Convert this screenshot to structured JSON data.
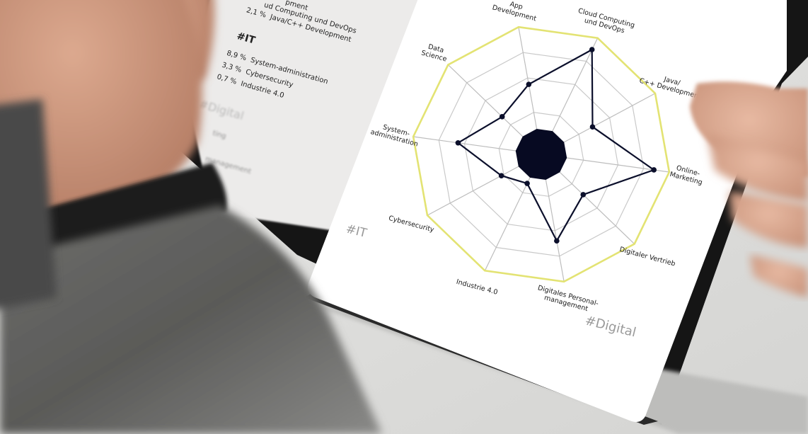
{
  "sidebar": {
    "top_line_partial": "ud Computing und DevOps",
    "top_line_partial2": "pment",
    "top_stat": {
      "value": "2,1 %",
      "label": "Java/C++ Development"
    },
    "it_heading": "#IT",
    "it_stats": [
      {
        "value": "8,9 %",
        "label": "System-administration"
      },
      {
        "value": "3,3 %",
        "label": "Cybersecurity"
      },
      {
        "value": "0,7 %",
        "label": "Industrie 4.0"
      }
    ],
    "digital_heading": "#Digital",
    "digital_partial_1": "ting",
    "digital_partial_2": "management"
  },
  "radar": {
    "axes": [
      {
        "lines": [
          "App",
          "Development"
        ]
      },
      {
        "lines": [
          "Cloud Computing",
          "und DevOps"
        ]
      },
      {
        "lines": [
          "Java/",
          "C++ Development"
        ]
      },
      {
        "lines": [
          "Online-",
          "Marketing"
        ]
      },
      {
        "lines": [
          "Digitaler Vertrieb"
        ]
      },
      {
        "lines": [
          "Digitales Personal-",
          "management"
        ]
      },
      {
        "lines": [
          "Industrie 4.0"
        ]
      },
      {
        "lines": [
          "Cybersecurity"
        ]
      },
      {
        "lines": [
          "System-",
          "administration"
        ]
      },
      {
        "lines": [
          "Data",
          "Science"
        ]
      }
    ],
    "levels": [
      0.55,
      0.9,
      0.45,
      0.88,
      0.45,
      0.68,
      0.25,
      0.35,
      0.65,
      0.42
    ],
    "group_tags": [
      "#IT",
      "#Digital"
    ],
    "colors": {
      "outer_ring": "#e3e373",
      "series": "#0b0f2b",
      "grid": "#c9c9c9",
      "center": "#070a22"
    }
  }
}
